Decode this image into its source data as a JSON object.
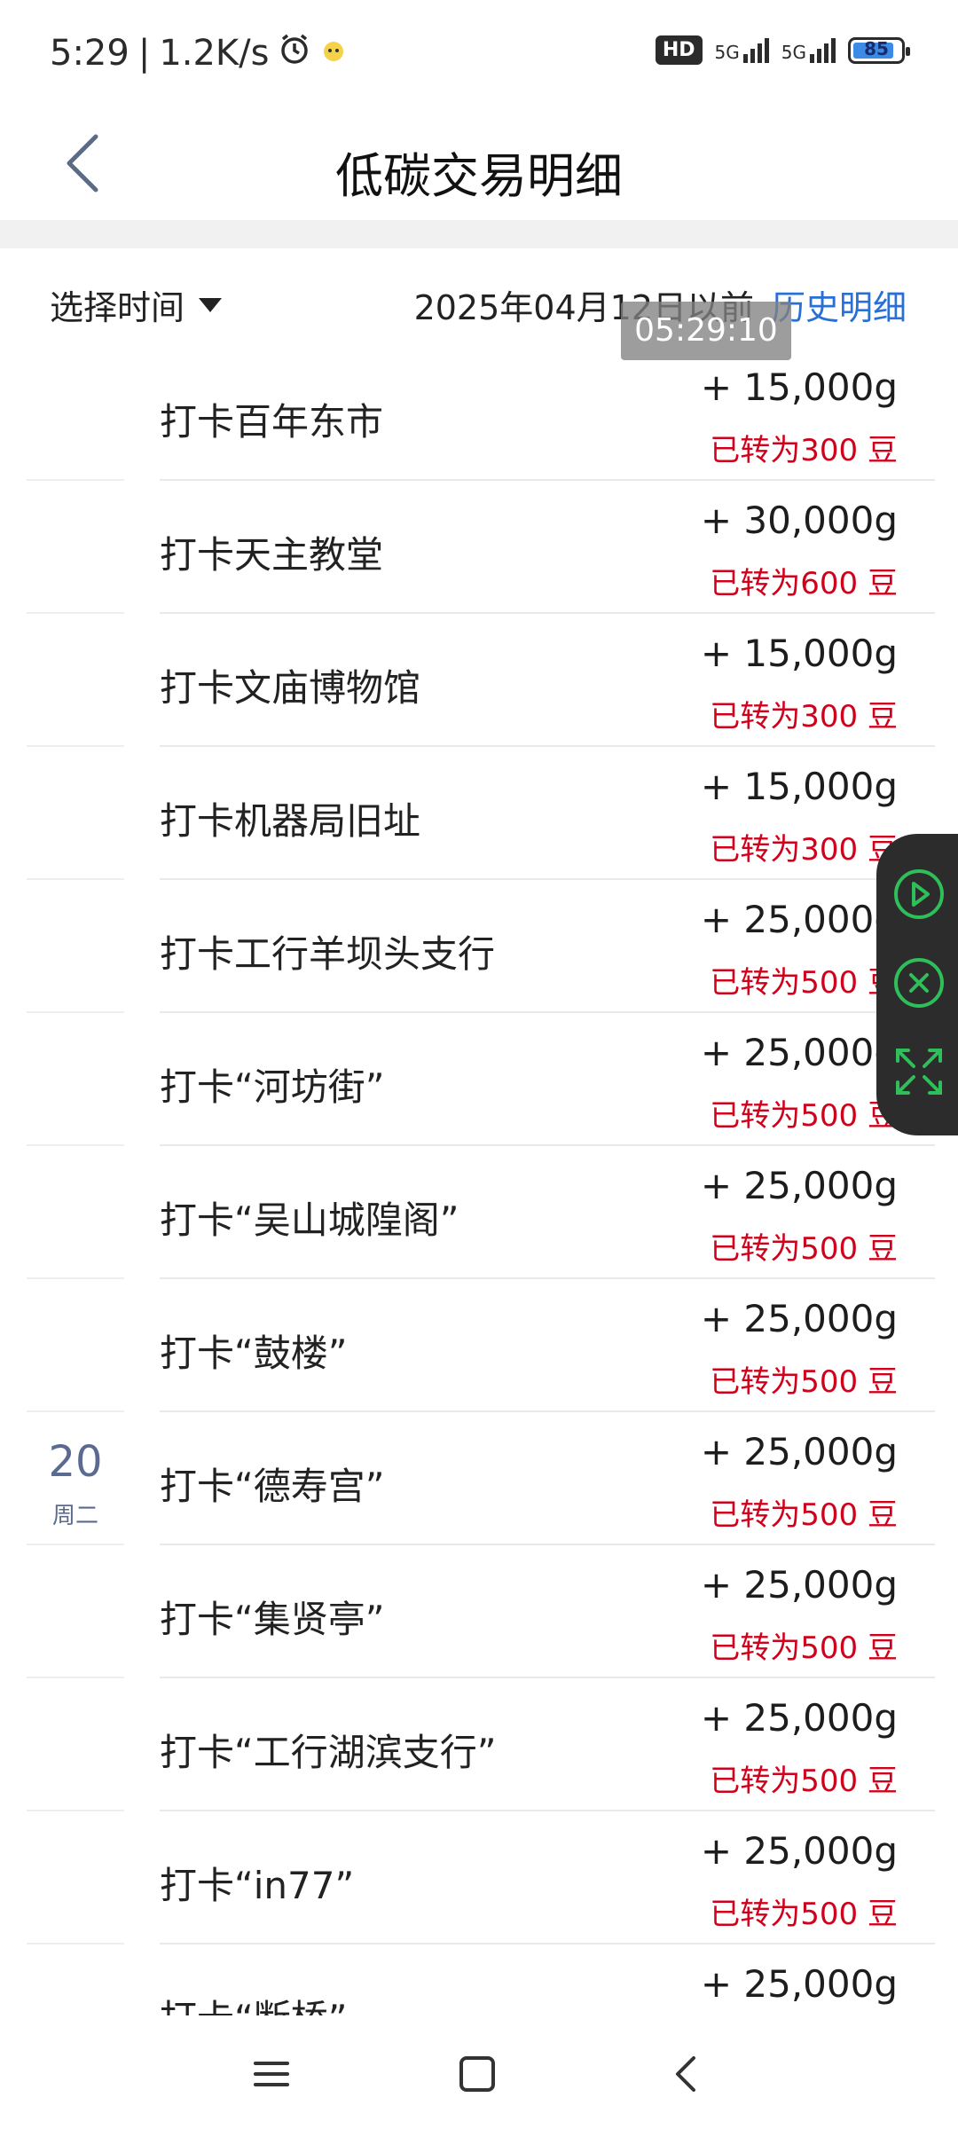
{
  "status_bar": {
    "time": "5:29",
    "speed": "1.2K/s",
    "hd_label": "HD",
    "network_1": "5G",
    "network_2": "5G",
    "battery": "85"
  },
  "header": {
    "title": "低碳交易明细"
  },
  "filter": {
    "select_label": "选择时间",
    "date_text": "2025年04月12日以前",
    "history_link": "历史明细"
  },
  "overlay_clock": "05:29:10",
  "date_group": {
    "day": "20",
    "weekday": "周二"
  },
  "transactions": [
    {
      "title": "打卡百年东市",
      "amount": "+ 15,000g",
      "note": "已转为300 豆"
    },
    {
      "title": "打卡天主教堂",
      "amount": "+ 30,000g",
      "note": "已转为600 豆"
    },
    {
      "title": "打卡文庙博物馆",
      "amount": "+ 15,000g",
      "note": "已转为300 豆"
    },
    {
      "title": "打卡机器局旧址",
      "amount": "+ 15,000g",
      "note": "已转为300 豆"
    },
    {
      "title": "打卡工行羊坝头支行",
      "amount": "+ 25,000g",
      "note": "已转为500 豆"
    },
    {
      "title": "打卡“河坊街”",
      "amount": "+ 25,000g",
      "note": "已转为500 豆"
    },
    {
      "title": "打卡“吴山城隍阁”",
      "amount": "+ 25,000g",
      "note": "已转为500 豆"
    },
    {
      "title": "打卡“鼓楼”",
      "amount": "+ 25,000g",
      "note": "已转为500 豆"
    },
    {
      "title": "打卡“德寿宫”",
      "amount": "+ 25,000g",
      "note": "已转为500 豆"
    },
    {
      "title": "打卡“集贤亭”",
      "amount": "+ 25,000g",
      "note": "已转为500 豆"
    },
    {
      "title": "打卡“工行湖滨支行”",
      "amount": "+ 25,000g",
      "note": "已转为500 豆"
    },
    {
      "title": "打卡“in77”",
      "amount": "+ 25,000g",
      "note": "已转为500 豆"
    },
    {
      "title": "打卡“断桥”",
      "amount": "+ 25,000g",
      "note": ""
    }
  ],
  "colors": {
    "accent_link": "#2a6fd6",
    "note_red": "#d0021b",
    "date_blue": "#5a6a90",
    "float_green": "#2fbf5a"
  }
}
